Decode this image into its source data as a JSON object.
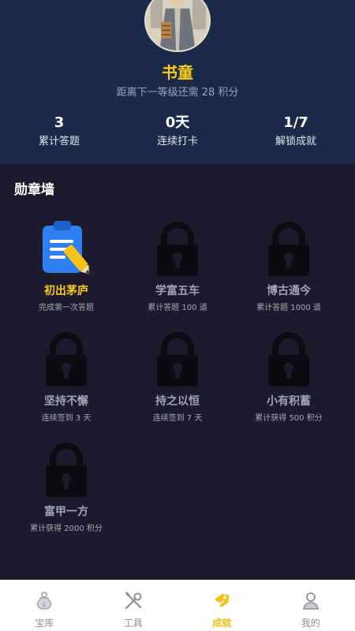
{
  "profile": {
    "level_name": "书童",
    "level_hint": "距离下一等级还需 28 积分"
  },
  "stats": [
    {
      "value": "3",
      "label": "累计答题"
    },
    {
      "value": "0天",
      "label": "连续打卡"
    },
    {
      "value": "1/7",
      "label": "解锁成就"
    }
  ],
  "badge_wall": {
    "title": "勋章墙",
    "badges": [
      {
        "name": "初出茅庐",
        "desc": "完成第一次答题",
        "unlocked": true,
        "icon": "clipboard-pencil-icon"
      },
      {
        "name": "学富五车",
        "desc": "累计答题 100 道",
        "unlocked": false,
        "icon": "lock-icon"
      },
      {
        "name": "博古通今",
        "desc": "累计答题 1000 道",
        "unlocked": false,
        "icon": "lock-icon"
      },
      {
        "name": "坚持不懈",
        "desc": "连续签到 3 天",
        "unlocked": false,
        "icon": "lock-icon"
      },
      {
        "name": "持之以恒",
        "desc": "连续签到 7 天",
        "unlocked": false,
        "icon": "lock-icon"
      },
      {
        "name": "小有积蓄",
        "desc": "累计获得 500 积分",
        "unlocked": false,
        "icon": "lock-icon"
      },
      {
        "name": "富甲一方",
        "desc": "累计获得 2000 积分",
        "unlocked": false,
        "icon": "lock-icon"
      }
    ]
  },
  "tabbar": {
    "items": [
      {
        "label": "宝库",
        "icon": "treasure-bag-icon",
        "active": false
      },
      {
        "label": "工具",
        "icon": "tools-icon",
        "active": false
      },
      {
        "label": "成就",
        "icon": "achievement-tag-icon",
        "active": true
      },
      {
        "label": "我的",
        "icon": "user-icon",
        "active": false
      }
    ]
  },
  "colors": {
    "header_bg": "#1c2a49",
    "page_bg": "#1b1b2d",
    "accent": "#f7cc1f",
    "lock": "#0b0b11"
  }
}
